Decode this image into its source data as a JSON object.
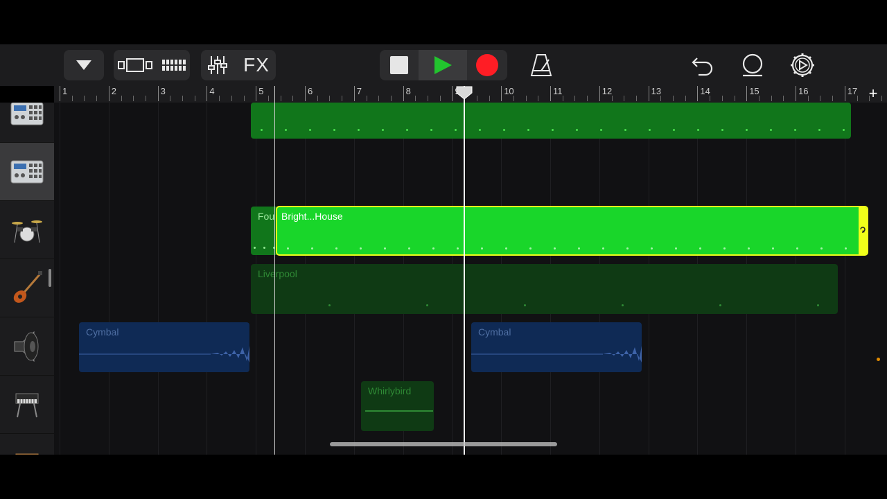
{
  "toolbar": {
    "browser_button": "chevron-down-icon",
    "view_buttons": [
      "tracks-view-icon",
      "live-loops-icon"
    ],
    "mixer_button": "mixer-sliders-icon",
    "fx_label": "FX",
    "transport": {
      "stop": "stop-icon",
      "play": "play-icon",
      "record": "record-icon"
    },
    "metronome": "metronome-icon",
    "undo": "undo-icon",
    "loop_browser": "loop-browser-icon",
    "settings": "gear-icon"
  },
  "ruler": {
    "bars": [
      "1",
      "2",
      "3",
      "4",
      "5",
      "6",
      "7",
      "8",
      "9",
      "10",
      "11",
      "12",
      "13",
      "14",
      "15",
      "16",
      "17"
    ],
    "add_label": "+"
  },
  "tracks": [
    {
      "instrument": "drum-machine-icon",
      "region": ""
    },
    {
      "instrument": "drum-machine-icon",
      "region": ""
    },
    {
      "instrument": "drum-kit-icon",
      "region_a": "Fou",
      "region_b": "Bright...House"
    },
    {
      "instrument": "bass-guitar-icon",
      "region": "Liverpool"
    },
    {
      "instrument": "speaker-icon",
      "region_a": "Cymbal",
      "region_b": "Cymbal"
    },
    {
      "instrument": "keyboard-icon",
      "region": "Whirlybird"
    },
    {
      "instrument": "synth-icon",
      "region": ""
    }
  ],
  "colors": {
    "accent_green": "#19d62a",
    "selected_region": "#19d62a",
    "dim_green": "#0f5a16",
    "audio_blue": "#0f2a55",
    "record_red": "#ff1d25",
    "play_green": "#22c42e",
    "loop_handle": "#f0ff1a"
  }
}
